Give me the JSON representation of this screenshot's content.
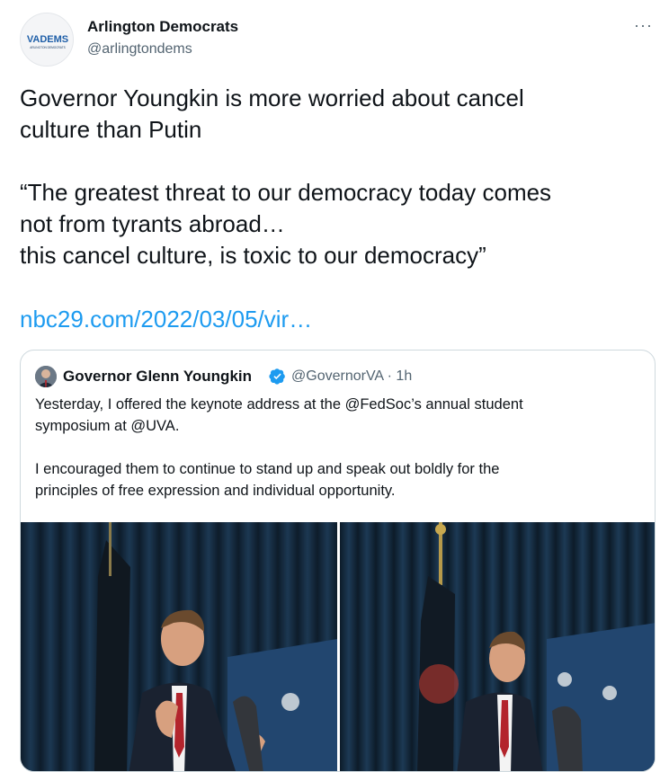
{
  "tweet": {
    "author_name": "Arlington Democrats",
    "author_handle": "@arlingtondems",
    "avatar_logo_text": "VADEMS",
    "avatar_logo_subtext": "ARLINGTON DEMOCRATS",
    "more_label": "···",
    "lines": [
      "Governor Youngkin is more worried about cancel",
      "culture than Putin",
      "",
      "“The greatest threat to our democracy today comes",
      "not from tyrants abroad…",
      "this cancel culture, is toxic to our democracy”"
    ],
    "link_text": "nbc29.com/2022/03/05/vir…"
  },
  "quoted": {
    "author_name": "Governor Glenn Youngkin",
    "verified_icon": "verified-badge-icon",
    "handle_time": "@GovernorVA · 1h",
    "lines": [
      "Yesterday, I offered the keynote address at the @FedSoc’s annual student",
      "symposium at @UVA.",
      "",
      "I encouraged them to continue to stand up and speak out boldly for the",
      "principles of free expression and individual opportunity."
    ]
  },
  "colors": {
    "link": "#1d9bf0",
    "verified": "#1d9bf0",
    "secondary_text": "#536471",
    "border": "#cfd9de"
  }
}
